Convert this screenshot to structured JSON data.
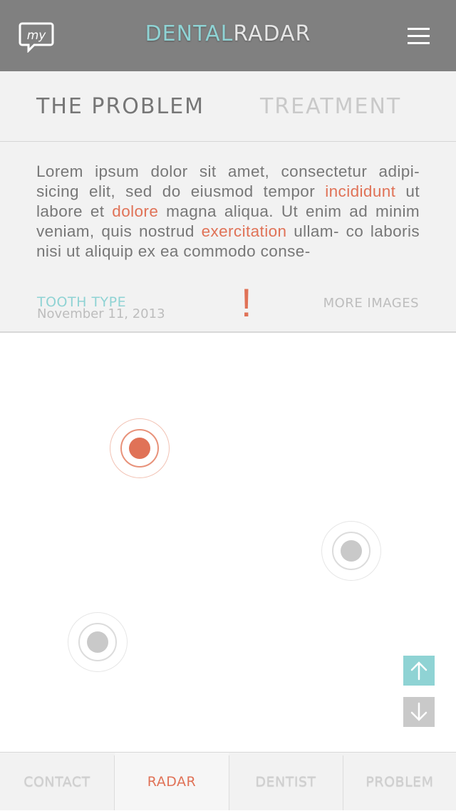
{
  "header": {
    "logo_text": "my",
    "brand_part1": "DENTAL",
    "brand_part2": "RADAR",
    "menu_icon": "hamburger-menu-icon"
  },
  "tabs": [
    {
      "label": "THE PROBLEM",
      "active": true
    },
    {
      "label": "TREATMENT",
      "active": false
    }
  ],
  "description": {
    "parts": [
      "Lorem ipsum dolor sit amet, consectetur adipi- sicing elit, sed do eiusmod tempor ",
      "incididunt",
      " ut labore et ",
      "dolore",
      " magna aliqua. Ut enim ad minim veniam, quis nostrud ",
      "exercitation",
      " ullam- co laboris nisi ut aliquip ex ea commodo conse-"
    ],
    "highlight_color": "#e07257"
  },
  "meta": {
    "tooth_type_label": "TOOTH TYPE",
    "date": "November 11, 2013",
    "alert_symbol": "!",
    "more_images_label": "MORE IMAGES"
  },
  "radar_markers": [
    {
      "status": "alert",
      "color": "#e07257"
    },
    {
      "status": "normal",
      "color": "#c9c9c9"
    },
    {
      "status": "normal",
      "color": "#c9c9c9"
    }
  ],
  "scroll_buttons": {
    "up_icon": "arrow-up-icon",
    "down_icon": "arrow-down-icon"
  },
  "bottom_nav": [
    {
      "label": "CONTACT",
      "active": false
    },
    {
      "label": "RADAR",
      "active": true
    },
    {
      "label": "DENTIST",
      "active": false
    },
    {
      "label": "PROBLEM",
      "active": false
    }
  ],
  "colors": {
    "accent_teal": "#8fd3d4",
    "accent_orange": "#e07257",
    "header_gray": "#808080"
  }
}
